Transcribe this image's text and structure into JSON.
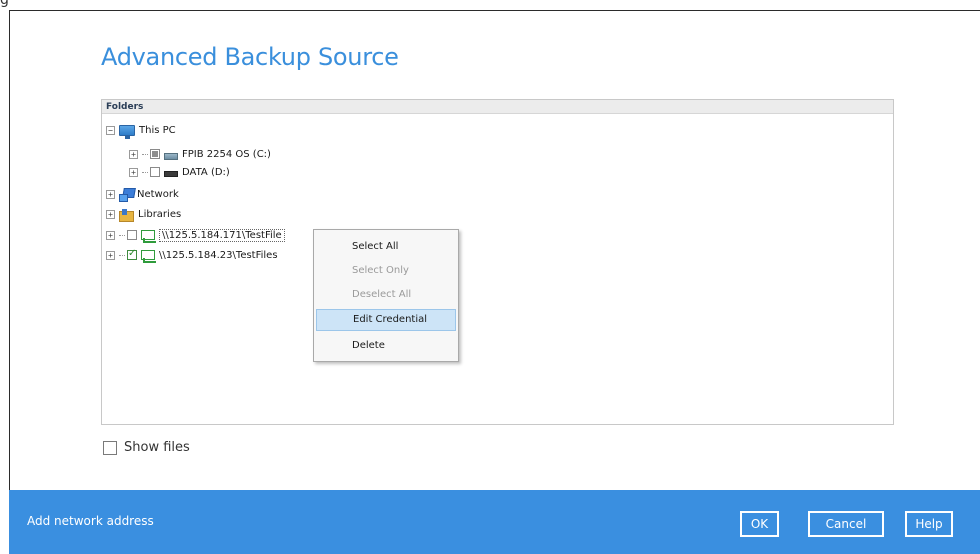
{
  "window": {
    "corner_glyph": "g",
    "title": "Advanced Backup Source"
  },
  "tree": {
    "header": "Folders",
    "items": [
      {
        "label": "This PC"
      },
      {
        "label": "FPIB 2254 OS (C:)"
      },
      {
        "label": "DATA (D:)"
      },
      {
        "label": "Network"
      },
      {
        "label": "Libraries"
      },
      {
        "label": "\\\\125.5.184.171\\TestFile"
      },
      {
        "label": "\\\\125.5.184.23\\TestFiles"
      }
    ]
  },
  "context_menu": {
    "items": [
      {
        "label": "Select All",
        "state": "enabled"
      },
      {
        "label": "Select Only",
        "state": "disabled"
      },
      {
        "label": "Deselect All",
        "state": "disabled"
      },
      {
        "label": "Edit Credential",
        "state": "highlighted"
      },
      {
        "label": "Delete",
        "state": "enabled"
      }
    ]
  },
  "options": {
    "show_files_label": "Show files"
  },
  "footer": {
    "add_network_label": "Add network address",
    "ok_label": "OK",
    "cancel_label": "Cancel",
    "help_label": "Help",
    "background_color": "#3a8fe0"
  },
  "colors": {
    "title": "#3a8fdc",
    "menu_highlight": "#cde4f7"
  }
}
